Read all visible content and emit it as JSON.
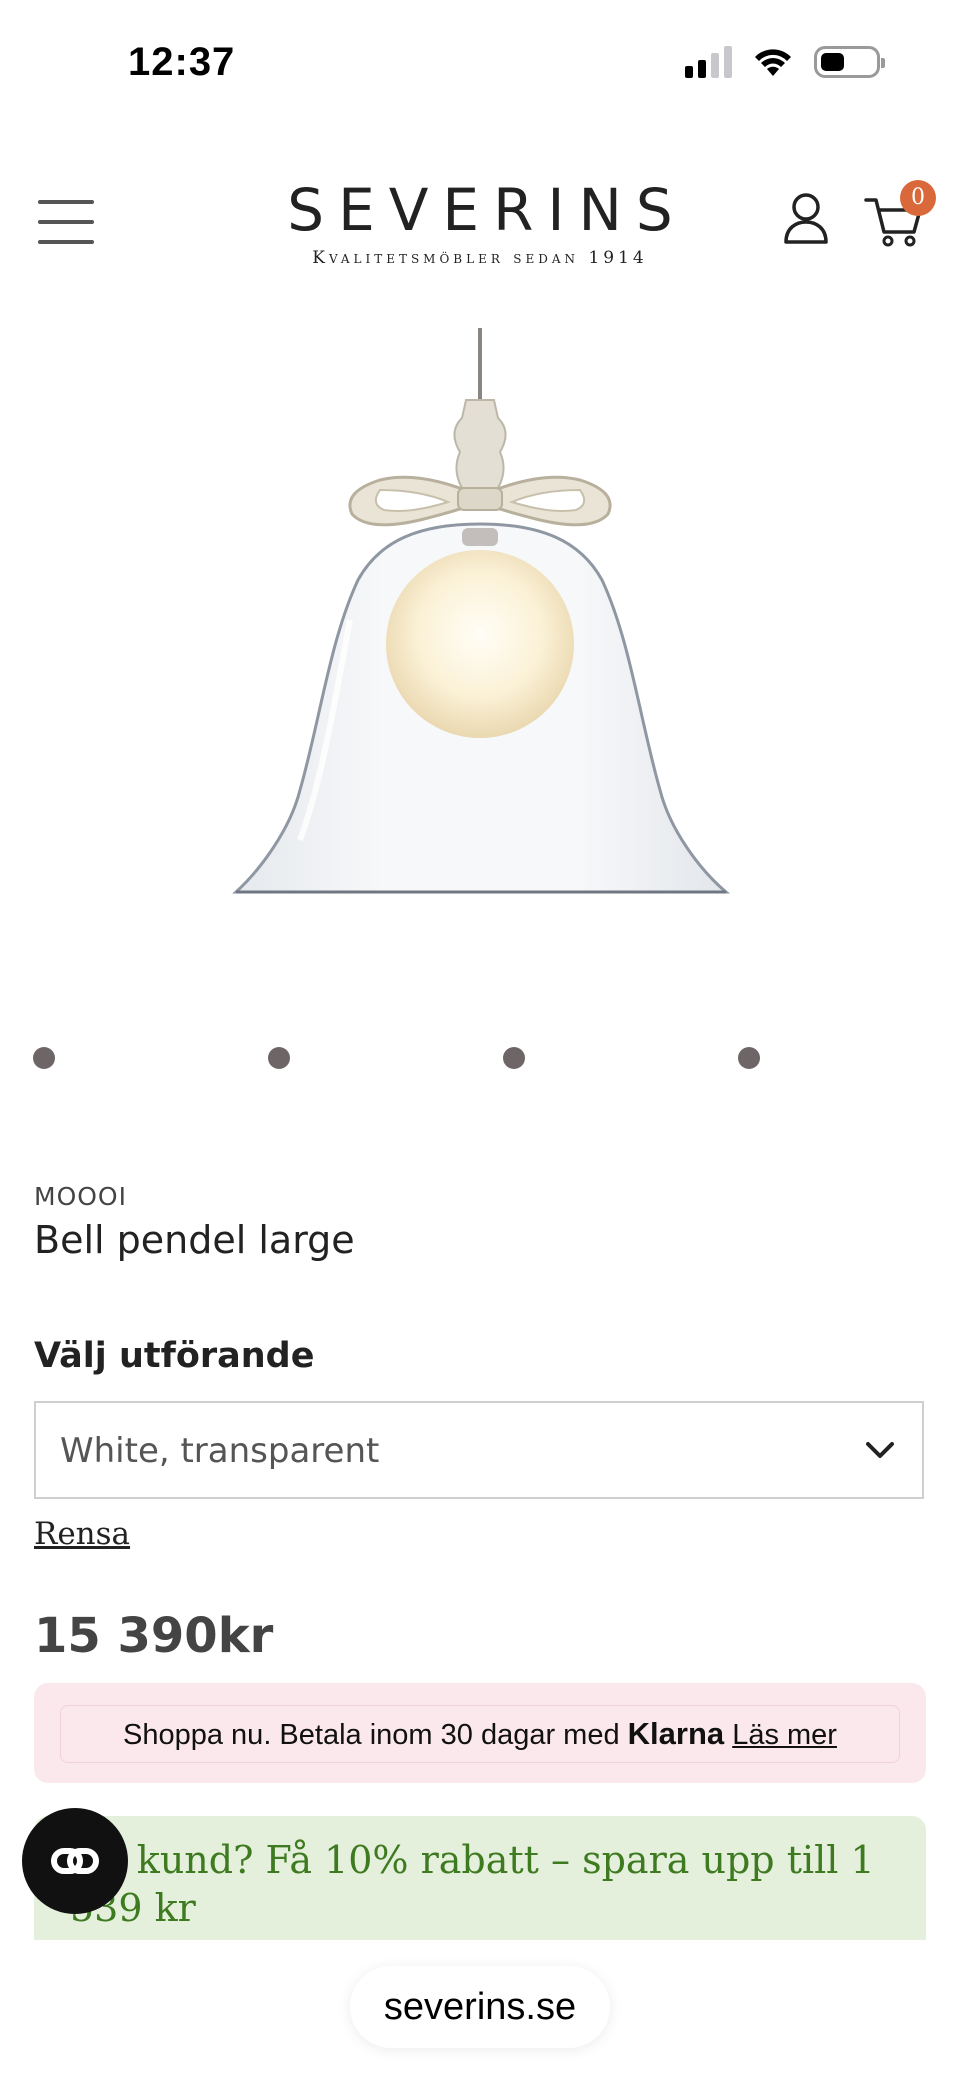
{
  "status_bar": {
    "time": "12:37",
    "battery_level": 0.45,
    "signal_bars_active": 2,
    "signal_bars_total": 4
  },
  "header": {
    "logo_name": "SEVERINS",
    "logo_tagline": "Kvalitetsmöbler sedan 1914",
    "menu_icon": "hamburger-icon",
    "account_icon": "user-icon",
    "cart_icon": "cart-icon",
    "cart_count": "0"
  },
  "carousel": {
    "dot_count": 4,
    "dot_color": "#6e6566"
  },
  "product": {
    "brand": "MOOOI",
    "name": "Bell pendel large",
    "variant_label": "Välj utförande",
    "variant_value": "White, transparent",
    "clear_label": "Rensa",
    "price": "15 390kr"
  },
  "klarna": {
    "text": "Shoppa nu. Betala inom 30 dagar med",
    "brand": "Klarna",
    "link": "Läs mer",
    "background": "#fbe8ec"
  },
  "promo": {
    "text": "Ny kund? Få 10% rabatt – spara upp till 1 539 kr",
    "color": "#3e7a20",
    "background": "#e5f0dc"
  },
  "browser": {
    "url": "severins.se"
  },
  "colors": {
    "accent_badge": "#d9693a",
    "text": "#222222"
  }
}
